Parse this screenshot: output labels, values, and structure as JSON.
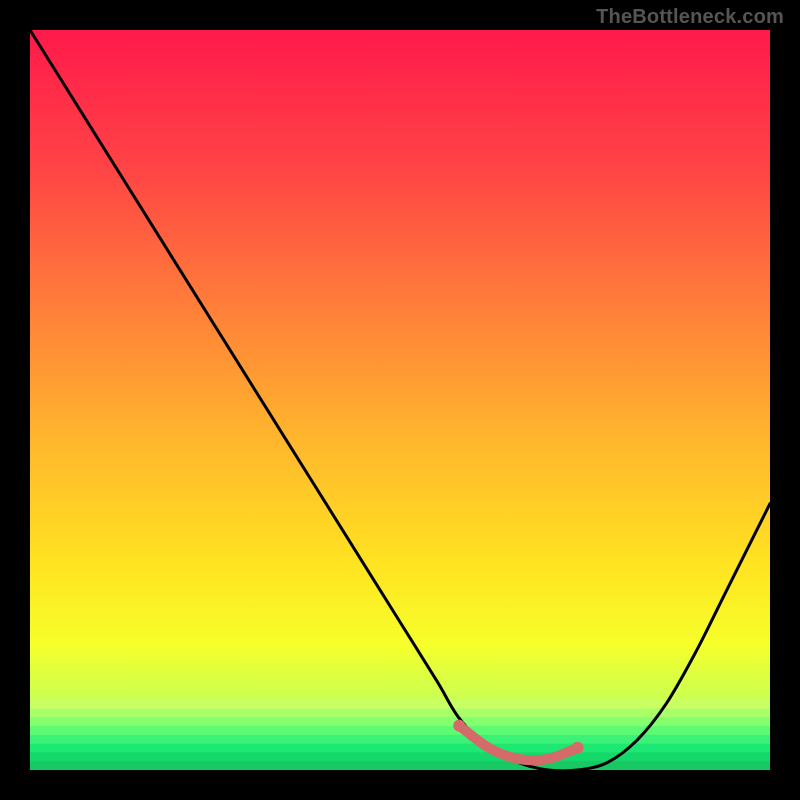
{
  "watermark": "TheBottleneck.com",
  "colors": {
    "bg": "#000000",
    "curve": "#000000",
    "highlight": "#d46a6a",
    "gradient_stops": [
      {
        "offset": 0.0,
        "color": "#ff1a4b"
      },
      {
        "offset": 0.18,
        "color": "#ff4246"
      },
      {
        "offset": 0.36,
        "color": "#ff7a3a"
      },
      {
        "offset": 0.55,
        "color": "#ffb52d"
      },
      {
        "offset": 0.72,
        "color": "#ffe321"
      },
      {
        "offset": 0.83,
        "color": "#f6ff2a"
      },
      {
        "offset": 0.91,
        "color": "#c7ff55"
      },
      {
        "offset": 0.96,
        "color": "#7dff7a"
      },
      {
        "offset": 1.0,
        "color": "#17e86a"
      }
    ],
    "bottom_green_bands": [
      "#c9ff63",
      "#a8ff68",
      "#84ff6e",
      "#5dfb73",
      "#3bf276",
      "#1ee874",
      "#15d86a",
      "#17c863"
    ]
  },
  "chart_data": {
    "type": "line",
    "title": "",
    "xlabel": "",
    "ylabel": "",
    "xlim": [
      0,
      100
    ],
    "ylim": [
      0,
      100
    ],
    "series": [
      {
        "name": "bottleneck-curve",
        "x": [
          0,
          5,
          10,
          15,
          20,
          25,
          30,
          35,
          40,
          45,
          50,
          55,
          58,
          62,
          66,
          70,
          74,
          78,
          82,
          86,
          90,
          94,
          98,
          100
        ],
        "y": [
          100,
          92,
          84,
          76,
          68,
          60,
          52,
          44,
          36,
          28,
          20,
          12,
          7,
          3,
          1,
          0,
          0,
          1,
          4,
          9,
          16,
          24,
          32,
          36
        ]
      }
    ],
    "highlight_segment": {
      "name": "optimal-range",
      "x": [
        58,
        62,
        66,
        70,
        74
      ],
      "y": [
        6,
        3,
        1.5,
        1.5,
        3
      ]
    }
  }
}
